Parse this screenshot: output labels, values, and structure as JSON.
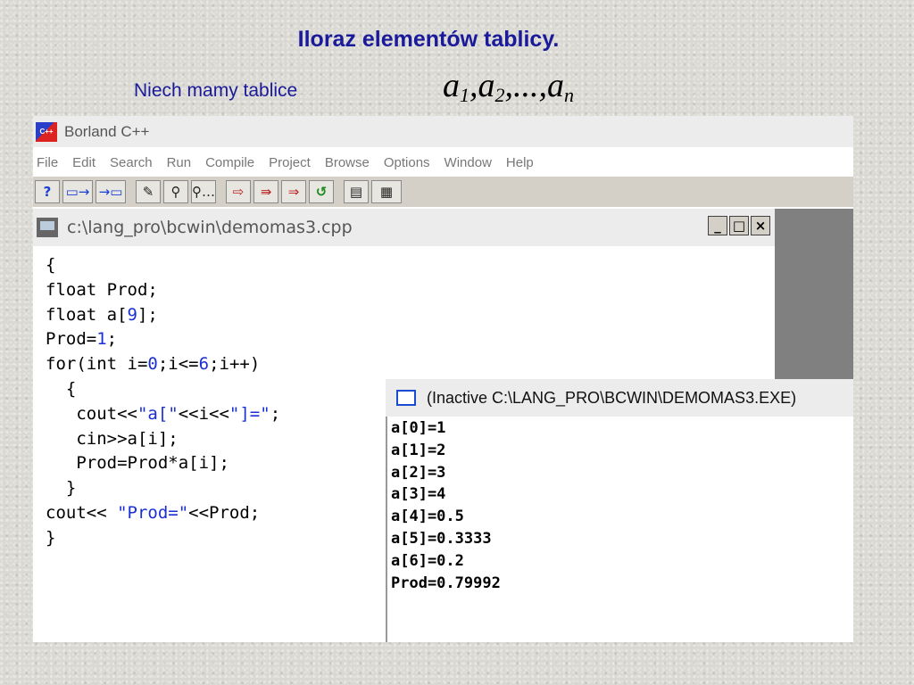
{
  "slide": {
    "title": "Iloraz elementów tablicy.",
    "subtitle": "Niech mamy tablice",
    "formula": {
      "a1": "a",
      "s1": "1",
      "a2": "a",
      "s2": "2",
      "sep": ",...,",
      "an": "a",
      "sn": "n",
      "comma": ","
    }
  },
  "ide": {
    "app_title": "Borland C++",
    "app_icon_text": "C++",
    "menu": [
      "File",
      "Edit",
      "Search",
      "Run",
      "Compile",
      "Project",
      "Browse",
      "Options",
      "Window",
      "Help"
    ],
    "editor": {
      "title": "c:\\lang_pro\\bcwin\\demomas3.cpp",
      "minimize": "_",
      "maximize": "□",
      "close": "×"
    }
  },
  "code_lines": [
    "{",
    "float Prod;",
    "float a[9];",
    "Prod=1;",
    "for(int i=0;i<=6;i++)",
    "  {",
    "   cout<<\"a[\"<<i<<\"]=\";",
    "   cin>>a[i];",
    "   Prod=Prod*a[i];",
    "  }",
    "cout<< \"Prod=\"<<Prod;",
    "}"
  ],
  "console": {
    "title": "(Inactive C:\\LANG_PRO\\BCWIN\\DEMOMAS3.EXE)",
    "lines": [
      "a[0]=1",
      "a[1]=2",
      "a[2]=3",
      "a[3]=4",
      "a[4]=0.5",
      "a[5]=0.3333",
      "a[6]=0.2",
      "Prod=0.79992"
    ]
  },
  "colors": {
    "title_blue": "#1a1a9a",
    "code_highlight": "#1a2fd6"
  }
}
